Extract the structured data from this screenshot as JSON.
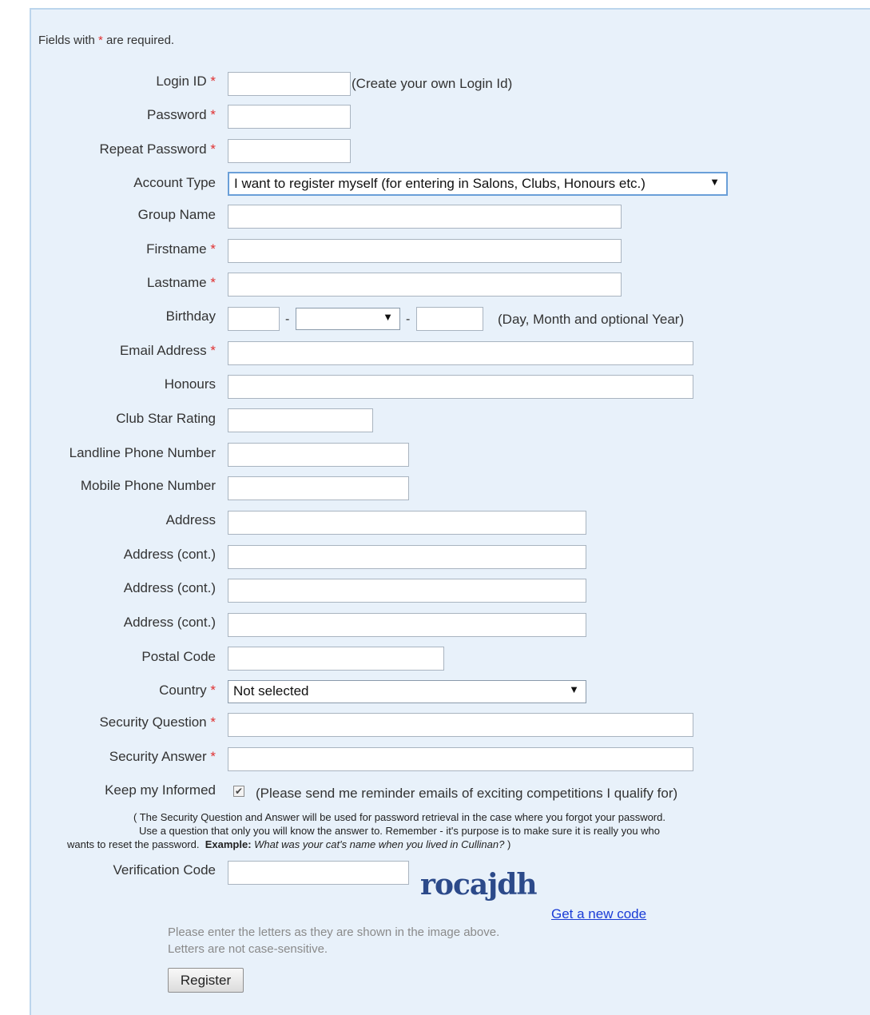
{
  "form": {
    "required_note_prefix": "Fields with ",
    "required_star": "*",
    "required_note_suffix": " are required.",
    "login_id": {
      "label": "Login ID",
      "value": "",
      "hint": "(Create your own Login Id)"
    },
    "password": {
      "label": "Password",
      "value": ""
    },
    "repeat_password": {
      "label": "Repeat Password",
      "value": ""
    },
    "account_type": {
      "label": "Account Type",
      "selected": "I want to register myself (for entering in Salons, Clubs, Honours etc.)"
    },
    "group_name": {
      "label": "Group Name",
      "value": ""
    },
    "firstname": {
      "label": "Firstname",
      "value": ""
    },
    "lastname": {
      "label": "Lastname",
      "value": ""
    },
    "birthday": {
      "label": "Birthday",
      "day": "",
      "month": "",
      "year": "",
      "separator": "-",
      "hint": "(Day, Month and optional Year)"
    },
    "email": {
      "label": "Email Address",
      "value": ""
    },
    "honours": {
      "label": "Honours",
      "value": ""
    },
    "club_star_rating": {
      "label": "Club Star Rating",
      "value": ""
    },
    "landline": {
      "label": "Landline Phone Number",
      "value": ""
    },
    "mobile": {
      "label": "Mobile Phone Number",
      "value": ""
    },
    "address1": {
      "label": "Address",
      "value": ""
    },
    "address2": {
      "label": "Address (cont.)",
      "value": ""
    },
    "address3": {
      "label": "Address (cont.)",
      "value": ""
    },
    "address4": {
      "label": "Address (cont.)",
      "value": ""
    },
    "postal_code": {
      "label": "Postal Code",
      "value": ""
    },
    "country": {
      "label": "Country",
      "selected": "Not selected"
    },
    "security_question": {
      "label": "Security Question",
      "value": ""
    },
    "security_answer": {
      "label": "Security Answer",
      "value": ""
    },
    "keep_informed": {
      "label": "Keep my Informed",
      "checked": true,
      "check_glyph": "✔",
      "hint": "(Please send me reminder emails of exciting competitions I qualify for)"
    },
    "security_note": {
      "line1": "( The Security Question and Answer will be used for password retrieval in the case where you forgot your password.",
      "line2": "Use a question that only you will know the answer to. Remember - it's purpose is to make sure it is really you who",
      "line3_prefix": "wants to reset the password.",
      "example_label": "Example:",
      "example_text": "What was your cat's name when you lived in Cullinan?",
      "line3_suffix": " )"
    },
    "verification": {
      "label": "Verification Code",
      "value": "",
      "captcha_text": "rocajdh",
      "new_code_link": "Get a new code",
      "instruction_line1": "Please enter the letters as they are shown in the image above.",
      "instruction_line2": "Letters are not case-sensitive."
    },
    "register_button": "Register"
  },
  "icons": {
    "dropdown_arrow": "▼"
  },
  "colors": {
    "panel_bg": "#e8f1fa",
    "panel_border": "#bcd5ec",
    "required": "#e03030",
    "link": "#1a3cd6",
    "captcha": "#2c4a8a"
  }
}
